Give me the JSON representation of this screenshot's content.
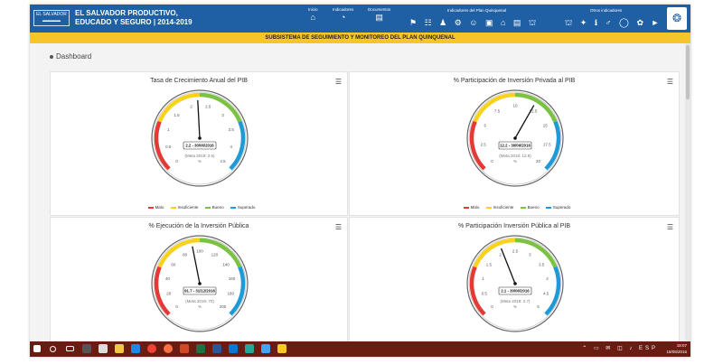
{
  "header": {
    "logo_text": "EL SALVADOR",
    "title_line1": "EL SALVADOR PRODUCTIVO,",
    "title_line2": "EDUCADO Y SEGURO | 2014-2019",
    "nav": [
      {
        "label": "Inicio",
        "icon": "home-icon"
      },
      {
        "label": "Indicadores",
        "icon": "gauge-icon"
      },
      {
        "label": "Documentos",
        "icon": "document-icon"
      }
    ],
    "group1_label": "Indicadores del Plan Quinquenal",
    "group1_icons": "⚑ ☷ ♟ ⚙ ☺ ▣ ⌂ ▤ ⛫",
    "group2_label": "Otros indicadores",
    "group2_icons": "⛫ ✦ ℹ ♂ ◯ ✿ ►",
    "seal_icon": "❂"
  },
  "subtitle": "SUBSISTEMA DE SEGUIMIENTO Y MONITOREO DEL PLAN QUINQUENAL",
  "breadcrumb": "Dashboard",
  "legend": {
    "malo": "Malo",
    "insuficiente": "Insuficiente",
    "bueno": "Bueno",
    "superado": "Superado"
  },
  "colors": {
    "malo": "#e53935",
    "insuficiente": "#f9d21d",
    "bueno": "#7cc242",
    "superado": "#1e9ad6",
    "header": "#1f5fa3",
    "subbar": "#f6c52a",
    "taskbar": "#6a1b12"
  },
  "gauges": [
    {
      "title": "Tasa de Crecimiento Anual del PIB",
      "value": 2.2,
      "value_label": "2.2 - 30/06/2016",
      "meta_label": "(Meta 2019: 2.5)",
      "unit": "%",
      "min": 0,
      "max": 4.5,
      "ticks": [
        "0",
        "0.5",
        "1",
        "1.5",
        "2",
        "2.5",
        "3",
        "3.5",
        "4",
        "4.5"
      ]
    },
    {
      "title": "% Participación de Inversión Privada al PIB",
      "value": 12.2,
      "value_label": "12.2 - 30/06/2016",
      "meta_label": "(Meta 2019: 12.8)",
      "unit": "%",
      "min": 0,
      "max": 20,
      "ticks": [
        "0",
        "2.5",
        "5",
        "7.5",
        "10",
        "12.5",
        "15",
        "17.5",
        "20"
      ]
    },
    {
      "title": "% Ejecución de la Inversión Pública",
      "value": 91.7,
      "value_label": "91.7 - 31/12/2016",
      "meta_label": "(Meta 2019: 70)",
      "unit": "%",
      "min": 0,
      "max": 200,
      "ticks": [
        "0",
        "20",
        "40",
        "60",
        "80",
        "100",
        "120",
        "140",
        "160",
        "180",
        "200"
      ]
    },
    {
      "title": "% Participación Inversión Pública al PIB",
      "value": 2.1,
      "value_label": "2.1 - 30/06/2016",
      "meta_label": "(Meta 2019: 2.7)",
      "unit": "%",
      "min": 0,
      "max": 5,
      "ticks": [
        "0",
        "0.5",
        "1",
        "1.5",
        "2",
        "2.5",
        "3",
        "3.5",
        "4",
        "4.5",
        "5"
      ]
    }
  ],
  "taskbar": {
    "tray_icons": "⌃ ▭ ✉ ◫ ♪ ESP",
    "time": "18:07",
    "date": "18/08/2016",
    "apps": [
      "start",
      "search",
      "task-view",
      "calculator",
      "store",
      "explorer",
      "edge",
      "chrome",
      "firefox",
      "powerpoint",
      "excel",
      "word",
      "photos",
      "paint",
      "mail",
      "folder"
    ]
  }
}
